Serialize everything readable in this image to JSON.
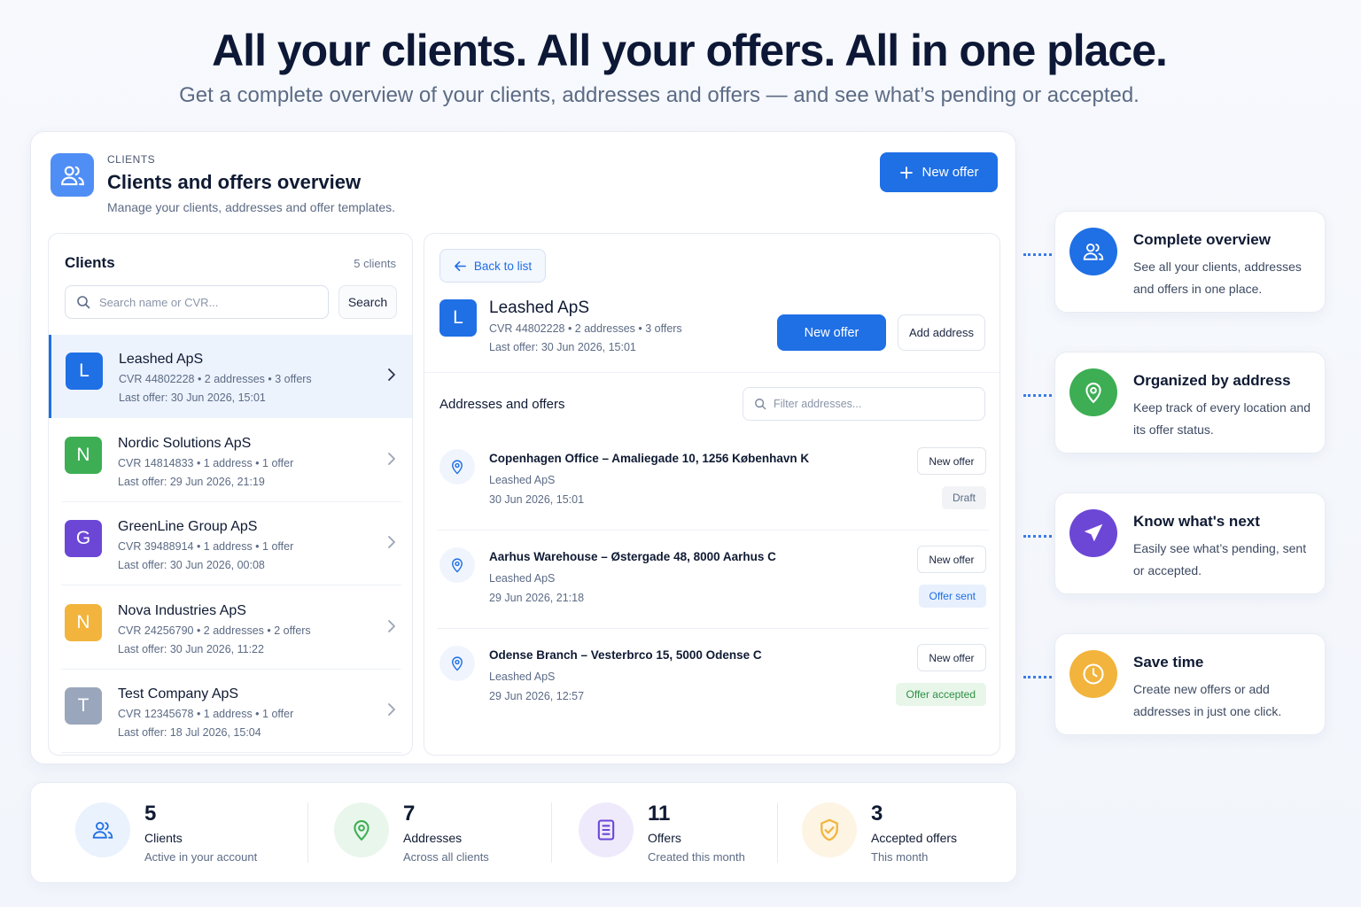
{
  "hero": {
    "title": "All your clients. All your offers. All in one place.",
    "subtitle": "Get a complete overview of your clients, addresses and offers — and see what’s pending or accepted."
  },
  "header": {
    "eyebrow": "CLIENTS",
    "title": "Clients and offers overview",
    "description": "Manage your clients, addresses and offer templates.",
    "new_offer_label": "New offer",
    "icon": "users-icon"
  },
  "clients_panel": {
    "title": "Clients",
    "count": "5 clients",
    "search_placeholder": "Search name or CVR...",
    "search_button": "Search",
    "items": [
      {
        "initial": "L",
        "name": "Leashed ApS",
        "meta": "CVR 44802228  •  2 addresses  •  3 offers",
        "last": "Last offer: 30 Jun 2026, 15:01",
        "color": "#1f6fe5",
        "active": true
      },
      {
        "initial": "N",
        "name": "Nordic Solutions ApS",
        "meta": "CVR 14814833  •  1 address  •  1 offer",
        "last": "Last offer: 29 Jun 2026, 21:19",
        "color": "#3dae54",
        "active": false
      },
      {
        "initial": "G",
        "name": "GreenLine Group ApS",
        "meta": "CVR 39488914  •  1 address  •  1 offer",
        "last": "Last offer: 30 Jun 2026, 00:08",
        "color": "#6c47d6",
        "active": false
      },
      {
        "initial": "N",
        "name": "Nova Industries ApS",
        "meta": "CVR 24256790  •  2 addresses  •  2 offers",
        "last": "Last offer: 30 Jun 2026, 11:22",
        "color": "#f2b43c",
        "active": false
      },
      {
        "initial": "T",
        "name": "Test Company ApS",
        "meta": "CVR 12345678  •  1 address  •  1 offer",
        "last": "Last offer: 18 Jul 2026, 15:04",
        "color": "#9aa6bb",
        "active": false
      }
    ]
  },
  "detail": {
    "back_label": "Back to list",
    "initial": "L",
    "name": "Leashed ApS",
    "meta": "CVR 44802228  •  2 addresses  •  3 offers",
    "last": "Last offer: 30 Jun 2026, 15:01",
    "new_offer_label": "New offer",
    "add_address_label": "Add address",
    "addresses_title": "Addresses and offers",
    "filter_placeholder": "Filter addresses...",
    "addresses": [
      {
        "title": "Copenhagen Office – Amaliegade 10, 1256 København K",
        "client": "Leashed ApS",
        "date": "30 Jun 2026, 15:01",
        "button": "New offer",
        "status": "Draft",
        "status_bg": "#f1f3f6",
        "status_fg": "#5c6b85"
      },
      {
        "title": "Aarhus Warehouse – Østergade 48, 8000 Aarhus C",
        "client": "Leashed ApS",
        "date": "29 Jun 2026, 21:18",
        "button": "New offer",
        "status": "Offer sent",
        "status_bg": "#e8f0fd",
        "status_fg": "#1f6fe5"
      },
      {
        "title": "Odense Branch – Vesterbrco 15, 5000 Odense C",
        "client": "Leashed ApS",
        "date": "29 Jun 2026, 12:57",
        "button": "New offer",
        "status": "Offer accepted",
        "status_bg": "#e8f6ea",
        "status_fg": "#2e8f43"
      }
    ]
  },
  "features": [
    {
      "title": "Complete overview",
      "desc": "See all your clients, addresses and offers in one place.",
      "icon": "users-icon",
      "color": "#1f6fe5"
    },
    {
      "title": "Organized by address",
      "desc": "Keep track of every location and its offer status.",
      "icon": "map-pin-icon",
      "color": "#3dae54"
    },
    {
      "title": "Know what's next",
      "desc": "Easily see what’s pending, sent or accepted.",
      "icon": "send-icon",
      "color": "#6c47d6"
    },
    {
      "title": "Save time",
      "desc": "Create new offers or add addresses in just one click.",
      "icon": "clock-icon",
      "color": "#f2b43c"
    }
  ],
  "stats": [
    {
      "number": "5",
      "label": "Clients",
      "sub": "Active in your account",
      "icon": "users-icon",
      "color": "#1f6fe5",
      "bg": "#eaf2fd"
    },
    {
      "number": "7",
      "label": "Addresses",
      "sub": "Across all clients",
      "icon": "map-pin-icon",
      "color": "#3dae54",
      "bg": "#e9f6ec"
    },
    {
      "number": "11",
      "label": "Offers",
      "sub": "Created this month",
      "icon": "document-icon",
      "color": "#6c47d6",
      "bg": "#efeafb"
    },
    {
      "number": "3",
      "label": "Accepted offers",
      "sub": "This month",
      "icon": "badge-check-icon",
      "color": "#f2b43c",
      "bg": "#fdf4e3"
    }
  ]
}
